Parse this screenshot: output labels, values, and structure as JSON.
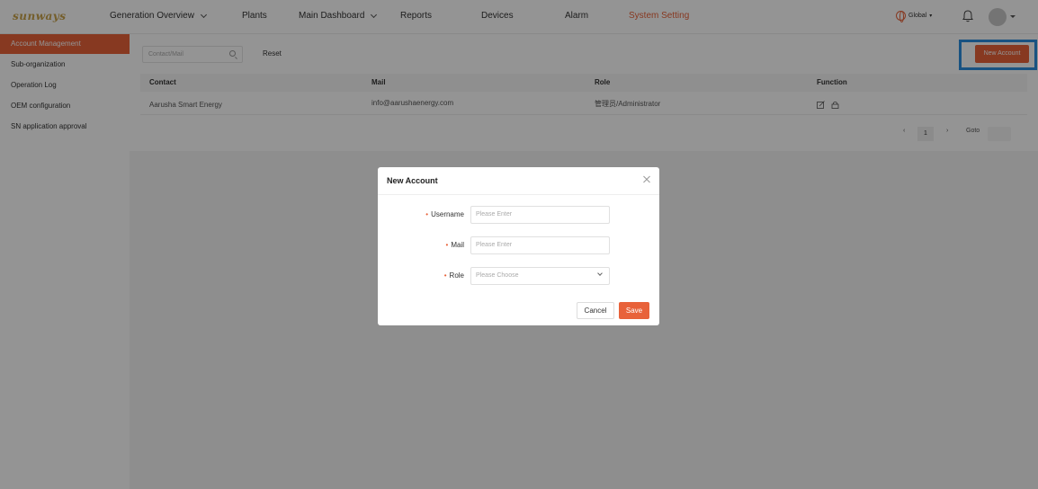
{
  "brand": {
    "logo_text": "sunways"
  },
  "nav": {
    "items": [
      {
        "label": "Generation Overview",
        "has_dropdown": true
      },
      {
        "label": "Plants",
        "has_dropdown": false
      },
      {
        "label": "Main Dashboard",
        "has_dropdown": true
      },
      {
        "label": "Reports",
        "has_dropdown": false
      },
      {
        "label": "Devices",
        "has_dropdown": false
      },
      {
        "label": "Alarm",
        "has_dropdown": false
      },
      {
        "label": "System Setting",
        "has_dropdown": false,
        "active": true
      }
    ],
    "region_label": "Global",
    "icons": {
      "region": "globe-icon",
      "notifications": "bell-icon",
      "user": "avatar"
    }
  },
  "sidebar": {
    "items": [
      {
        "label": "Account Management",
        "active": true
      },
      {
        "label": "Sub-organization"
      },
      {
        "label": "Operation Log"
      },
      {
        "label": "OEM configuration"
      },
      {
        "label": "SN application approval"
      }
    ]
  },
  "toolbar": {
    "search_placeholder": "Contact/Mail",
    "reset_label": "Reset",
    "new_account_label": "New Account"
  },
  "table": {
    "columns": [
      "Contact",
      "Mail",
      "Role",
      "Function"
    ],
    "rows": [
      {
        "contact": "Aarusha Smart Energy",
        "mail": "info@aarushaenergy.com",
        "role": "管理员/Administrator",
        "function_icons": [
          "edit-icon",
          "lock-icon"
        ]
      }
    ]
  },
  "pagination": {
    "current_page": "1",
    "goto_label": "Goto"
  },
  "modal": {
    "title": "New Account",
    "fields": [
      {
        "label": "Username",
        "required": true,
        "placeholder": "Please Enter"
      },
      {
        "label": "Mail",
        "required": true,
        "placeholder": "Please Enter"
      },
      {
        "label": "Role",
        "required": true,
        "placeholder": "Please Choose",
        "type": "select"
      }
    ],
    "cancel_label": "Cancel",
    "save_label": "Save"
  },
  "colors": {
    "accent": "#e8623a",
    "highlight": "#2b8ddf",
    "overlay": "rgba(0,0,0,0.42)"
  }
}
